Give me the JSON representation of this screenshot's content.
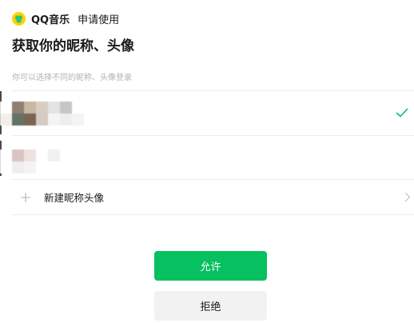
{
  "header": {
    "app_icon": "qq-music-logo",
    "app_name": "QQ音乐",
    "request_text": "申请使用"
  },
  "title": "获取你的昵称、头像",
  "hint": "你可以选择不同的昵称、头像登录",
  "accounts": [
    {
      "selected": true,
      "avatar": "pixelated-avatar",
      "nickname": ""
    },
    {
      "selected": false,
      "avatar": "pixelated-avatar",
      "nickname": ""
    }
  ],
  "new_account": {
    "icon": "plus-icon",
    "label": "新建昵称头像",
    "chevron": "chevron-right-icon"
  },
  "buttons": {
    "allow_label": "允许",
    "reject_label": "拒绝"
  },
  "colors": {
    "accent": "#07c160",
    "logo": "#ffd200",
    "reject_bg": "#f2f2f2",
    "hint": "#b2b2b2"
  }
}
